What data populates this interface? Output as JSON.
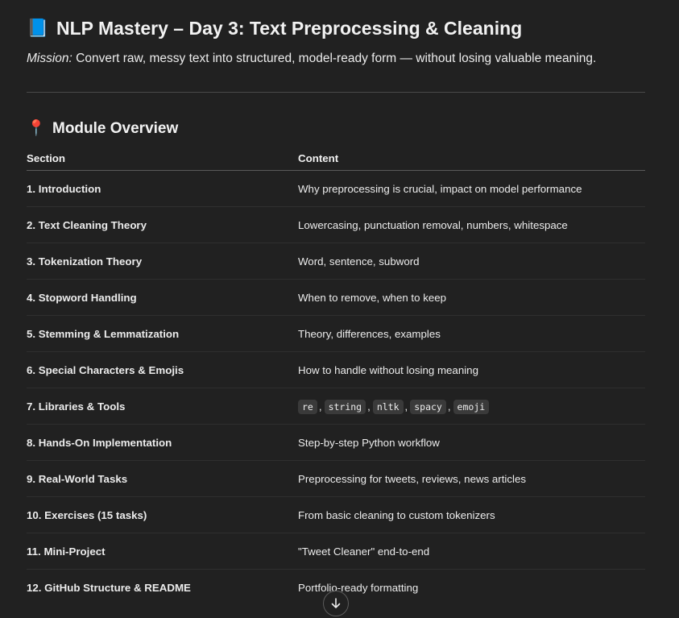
{
  "header": {
    "title_emoji": "📘",
    "title": "NLP Mastery – Day 3: Text Preprocessing & Cleaning",
    "mission_label": "Mission:",
    "mission_text": " Convert raw, messy text into structured, model-ready form — without losing valuable meaning."
  },
  "module": {
    "emoji": "📍",
    "title": "Module Overview",
    "columns": [
      "Section",
      "Content"
    ],
    "rows": [
      {
        "section": "1. Introduction",
        "content": "Why preprocessing is crucial, impact on model performance"
      },
      {
        "section": "2. Text Cleaning Theory",
        "content": "Lowercasing, punctuation removal, numbers, whitespace"
      },
      {
        "section": "3. Tokenization Theory",
        "content": "Word, sentence, subword"
      },
      {
        "section": "4. Stopword Handling",
        "content": "When to remove, when to keep"
      },
      {
        "section": "5. Stemming & Lemmatization",
        "content": "Theory, differences, examples"
      },
      {
        "section": "6. Special Characters & Emojis",
        "content": "How to handle without losing meaning"
      },
      {
        "section": "7. Libraries & Tools",
        "content_code": [
          "re",
          "string",
          "nltk",
          "spacy",
          "emoji"
        ],
        "separator": ","
      },
      {
        "section": "8. Hands-On Implementation",
        "content": "Step-by-step Python workflow"
      },
      {
        "section": "9. Real-World Tasks",
        "content": "Preprocessing for tweets, reviews, news articles"
      },
      {
        "section": "10. Exercises (15 tasks)",
        "content": "From basic cleaning to custom tokenizers"
      },
      {
        "section": "11. Mini-Project",
        "content": "\"Tweet Cleaner\" end-to-end"
      },
      {
        "section": "12. GitHub Structure & README",
        "content": "Portfolio-ready formatting"
      }
    ]
  },
  "scroll_button": {
    "icon": "arrow-down-icon"
  }
}
